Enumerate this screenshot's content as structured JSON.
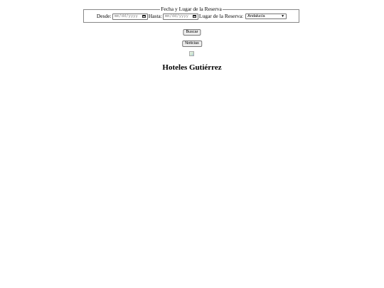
{
  "reservation": {
    "legend": "Fecha y Lugar de la Reserva",
    "from_label": "Desde:",
    "from_placeholder": "mm/dd/yyyy",
    "to_label": "Hasta:",
    "to_placeholder": "mm/dd/yyyy",
    "place_label": "Lugar de la Reserva:",
    "place_selected": "Andalucía"
  },
  "actions": {
    "search_label": "Buscar",
    "news_label": "Noticias"
  },
  "header": {
    "title": "Hoteles Gutiérrez"
  },
  "icons": {
    "calendar": "calendar-icon",
    "dropdown": "chevron-down-icon",
    "image": "broken-image-icon"
  }
}
